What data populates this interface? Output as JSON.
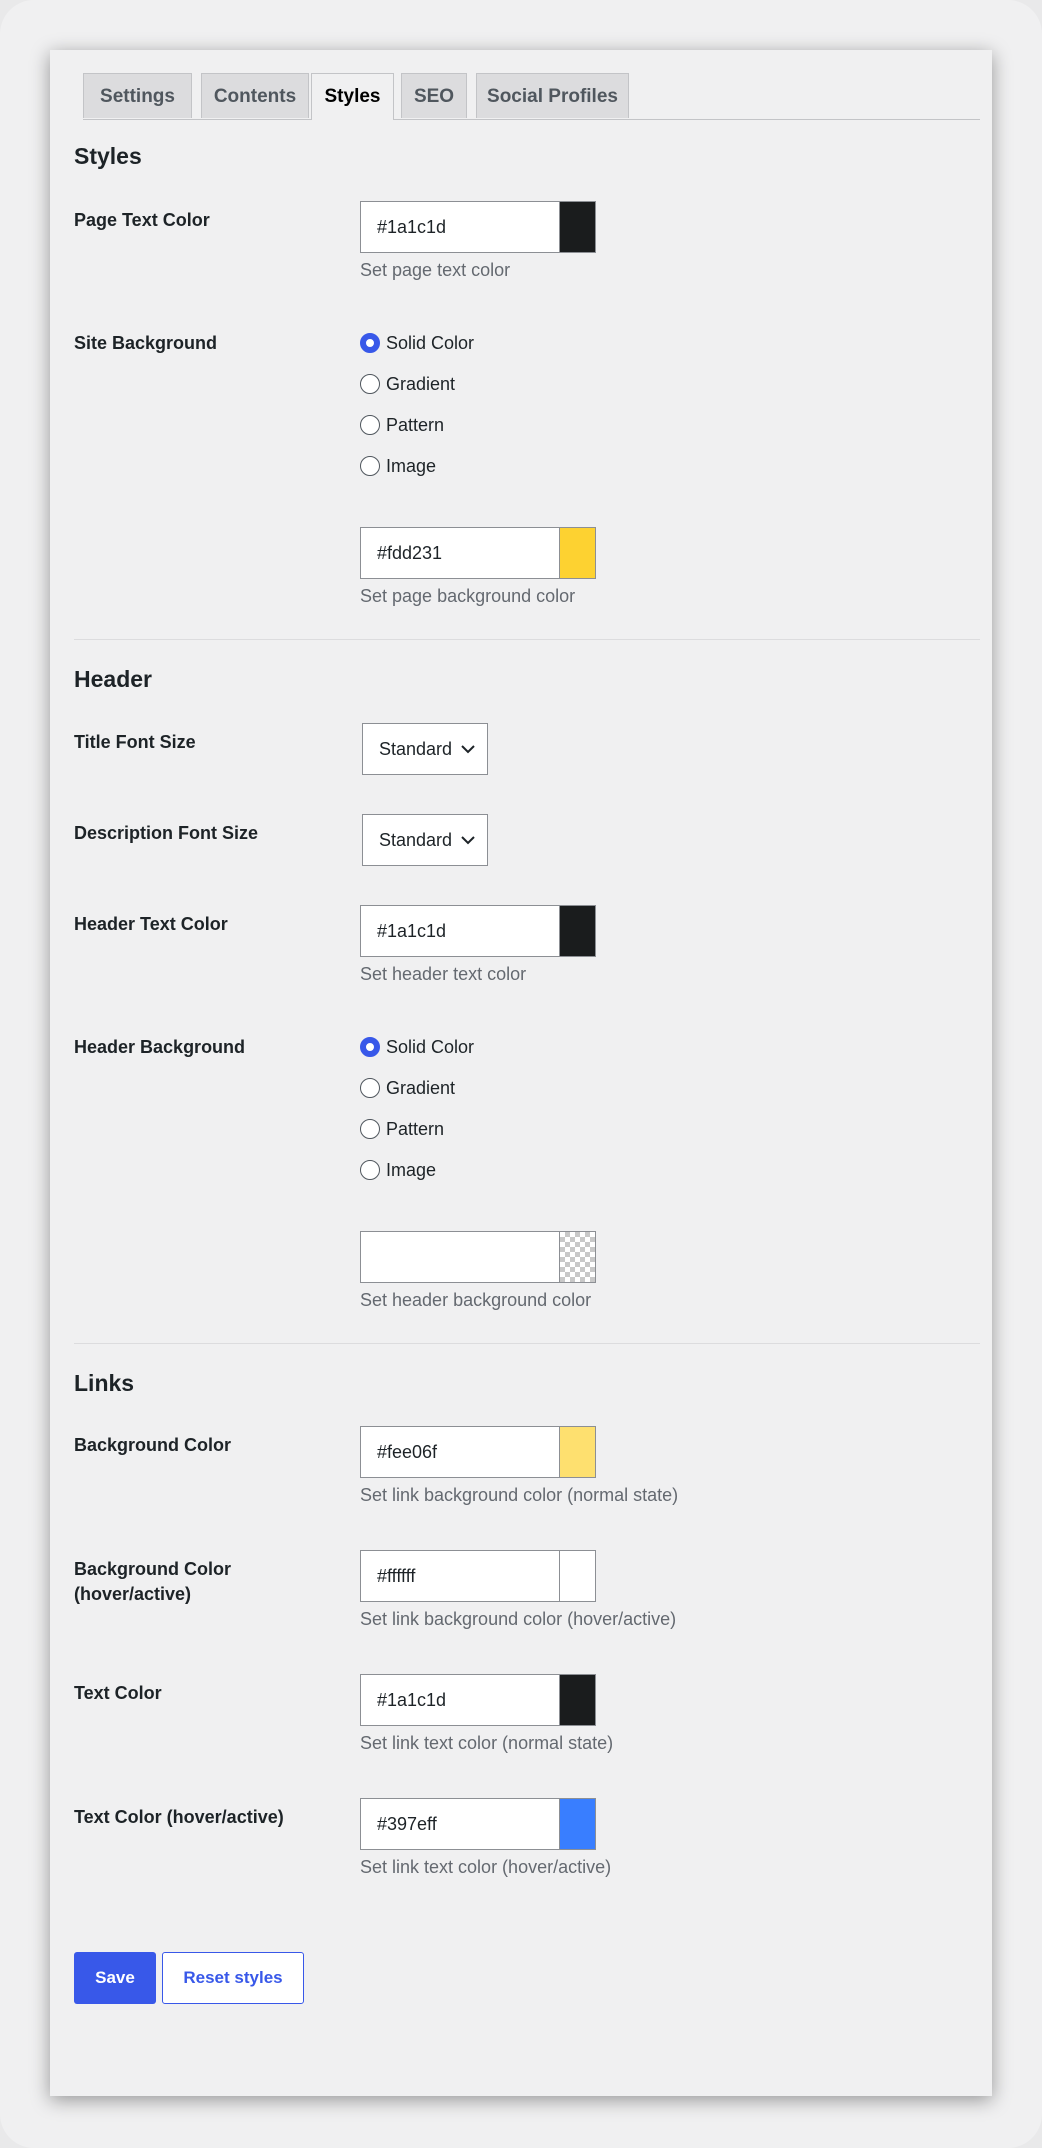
{
  "tabs": [
    {
      "label": "Settings",
      "active": false
    },
    {
      "label": "Contents",
      "active": false
    },
    {
      "label": "Styles",
      "active": true
    },
    {
      "label": "SEO",
      "active": false
    },
    {
      "label": "Social Profiles",
      "active": false
    }
  ],
  "styles": {
    "title": "Styles",
    "page_text_color": {
      "label": "Page Text Color",
      "value": "#1a1c1d",
      "swatch": "#1a1c1d",
      "desc": "Set page text color"
    },
    "site_background": {
      "label": "Site Background",
      "options": [
        "Solid Color",
        "Gradient",
        "Pattern",
        "Image"
      ],
      "selected": "Solid Color",
      "value": "#fdd231",
      "swatch": "#fdd231",
      "desc": "Set page background color"
    }
  },
  "header": {
    "title": "Header",
    "title_font_size": {
      "label": "Title Font Size",
      "value": "Standard"
    },
    "description_font_size": {
      "label": "Description Font Size",
      "value": "Standard"
    },
    "text_color": {
      "label": "Header Text Color",
      "value": "#1a1c1d",
      "swatch": "#1a1c1d",
      "desc": "Set header text color"
    },
    "background": {
      "label": "Header Background",
      "options": [
        "Solid Color",
        "Gradient",
        "Pattern",
        "Image"
      ],
      "selected": "Solid Color",
      "value": "",
      "swatch": "transparent",
      "desc": "Set header background color"
    }
  },
  "links": {
    "title": "Links",
    "bg_color": {
      "label": "Background Color",
      "value": "#fee06f",
      "swatch": "#fee06f",
      "desc": "Set link background color (normal state)"
    },
    "bg_color_hover": {
      "label_line1": "Background Color",
      "label_line2": "(hover/active)",
      "value": "#ffffff",
      "swatch": "#ffffff",
      "desc": "Set link background color (hover/active)"
    },
    "text_color": {
      "label": "Text Color",
      "value": "#1a1c1d",
      "swatch": "#1a1c1d",
      "desc": "Set link text color (normal state)"
    },
    "text_color_hover": {
      "label": "Text Color (hover/active)",
      "value": "#397eff",
      "swatch": "#397eff",
      "desc": "Set link text color (hover/active)"
    }
  },
  "buttons": {
    "save": "Save",
    "reset": "Reset styles"
  },
  "colors": {
    "accent": "#3858e9"
  }
}
